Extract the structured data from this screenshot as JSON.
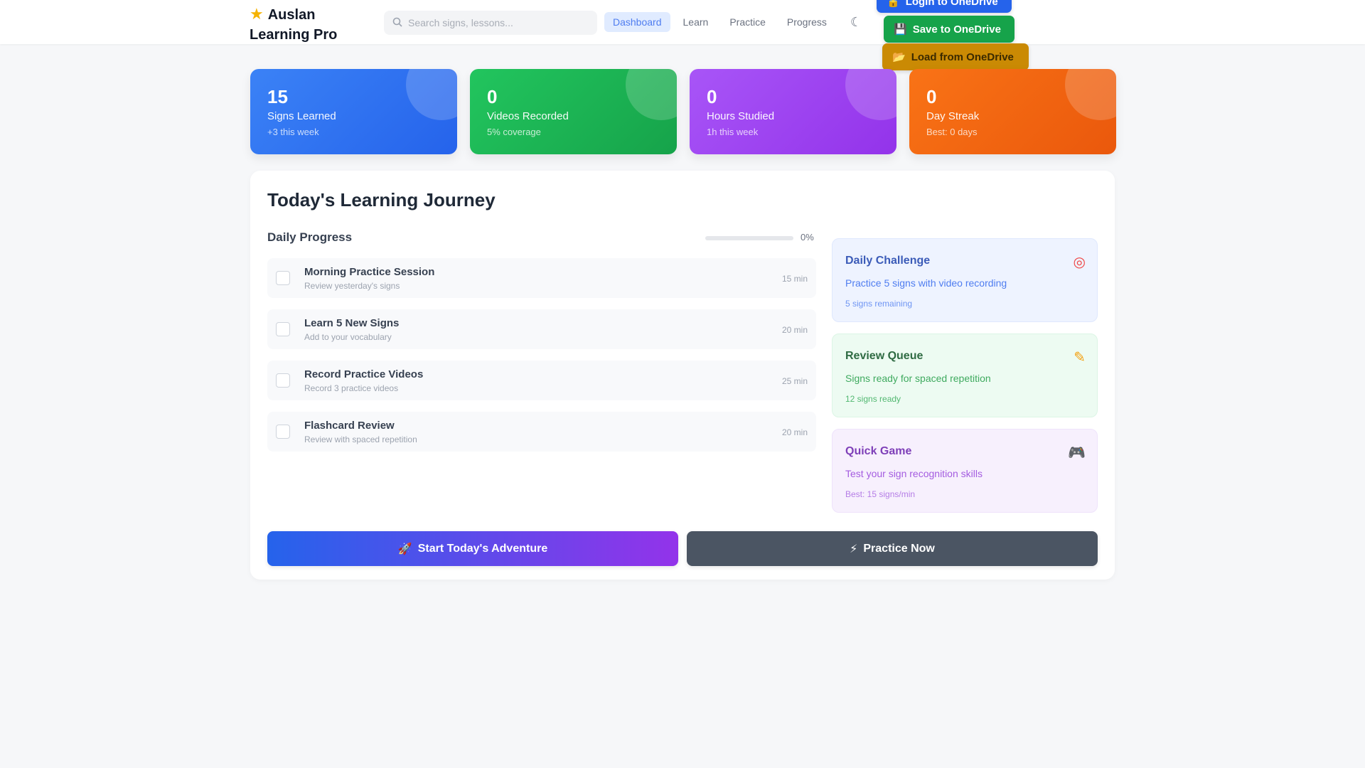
{
  "header": {
    "brand_line1": "Auslan",
    "brand_line2": "Learning Pro",
    "search_placeholder": "Search signs, lessons...",
    "nav": [
      {
        "label": "Dashboard",
        "active": true
      },
      {
        "label": "Learn",
        "active": false
      },
      {
        "label": "Practice",
        "active": false
      },
      {
        "label": "Progress",
        "active": false
      }
    ],
    "theme_icon": "moon-icon",
    "onedrive": {
      "login_label": "Login to OneDrive",
      "save_label": "Save to OneDrive",
      "load_label": "Load from OneDrive"
    }
  },
  "stats": [
    {
      "value": "15",
      "label": "Signs Learned",
      "sub": "+3 this week",
      "color": "#2563eb"
    },
    {
      "value": "0",
      "label": "Videos Recorded",
      "sub": "5% coverage",
      "color": "#16a34a"
    },
    {
      "value": "0",
      "label": "Hours Studied",
      "sub": "1h this week",
      "color": "#9333ea"
    },
    {
      "value": "0",
      "label": "Day Streak",
      "sub": "Best: 0 days",
      "color": "#ea580c"
    }
  ],
  "journey": {
    "title": "Today's Learning Journey",
    "progress_title": "Daily Progress",
    "progress_percent": "0%",
    "progress_value": 0,
    "tasks": [
      {
        "title": "Morning Practice Session",
        "sub": "Review yesterday's signs",
        "time": "15 min"
      },
      {
        "title": "Learn 5 New Signs",
        "sub": "Add to your vocabulary",
        "time": "20 min"
      },
      {
        "title": "Record Practice Videos",
        "sub": "Record 3 practice videos",
        "time": "25 min"
      },
      {
        "title": "Flashcard Review",
        "sub": "Review with spaced repetition",
        "time": "20 min"
      }
    ],
    "side_cards": [
      {
        "title": "Daily Challenge",
        "desc": "Practice 5 signs with video recording",
        "meta": "5 signs remaining",
        "icon": "target-icon"
      },
      {
        "title": "Review Queue",
        "desc": "Signs ready for spaced repetition",
        "meta": "12 signs ready",
        "icon": "pencil-icon"
      },
      {
        "title": "Quick Game",
        "desc": "Test your sign recognition skills",
        "meta": "Best: 15 signs/min",
        "icon": "gamepad-icon"
      }
    ],
    "start_label": "Start Today's Adventure",
    "practice_label": "Practice Now"
  }
}
